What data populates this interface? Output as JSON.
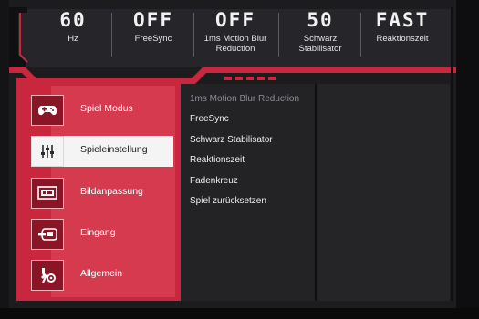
{
  "status": {
    "items": [
      {
        "value": "60",
        "label_lines": [
          "Hz"
        ]
      },
      {
        "value": "OFF",
        "label_lines": [
          "FreeSync"
        ]
      },
      {
        "value": "OFF",
        "label_lines": [
          "1ms Motion Blur",
          "Reduction"
        ]
      },
      {
        "value": "50",
        "label_lines": [
          "Schwarz",
          "Stabilisator"
        ]
      },
      {
        "value": "FAST",
        "label_lines": [
          "Reaktionszeit"
        ]
      }
    ]
  },
  "menu": {
    "items": [
      {
        "label": "Spiel Modus",
        "icon": "gamepad-icon",
        "active": false
      },
      {
        "label": "Spieleinstellung",
        "icon": "sliders-icon",
        "active": true
      },
      {
        "label": "Bildanpassung",
        "icon": "picture-icon",
        "active": false
      },
      {
        "label": "Eingang",
        "icon": "input-icon",
        "active": false
      },
      {
        "label": "Allgemein",
        "icon": "tools-icon",
        "active": false
      }
    ]
  },
  "submenu": {
    "items": [
      {
        "label": "1ms Motion Blur Reduction",
        "dim": true
      },
      {
        "label": "FreeSync",
        "dim": false
      },
      {
        "label": "Schwarz Stabilisator",
        "dim": false
      },
      {
        "label": "Reaktionszeit",
        "dim": false
      },
      {
        "label": "Fadenkreuz",
        "dim": false
      },
      {
        "label": "Spiel zurücksetzen",
        "dim": false
      }
    ]
  },
  "colors": {
    "accent": "#c8273d",
    "accent_light": "#d63a4f",
    "panel": "#232326",
    "active_bg": "#f4f4f4"
  }
}
